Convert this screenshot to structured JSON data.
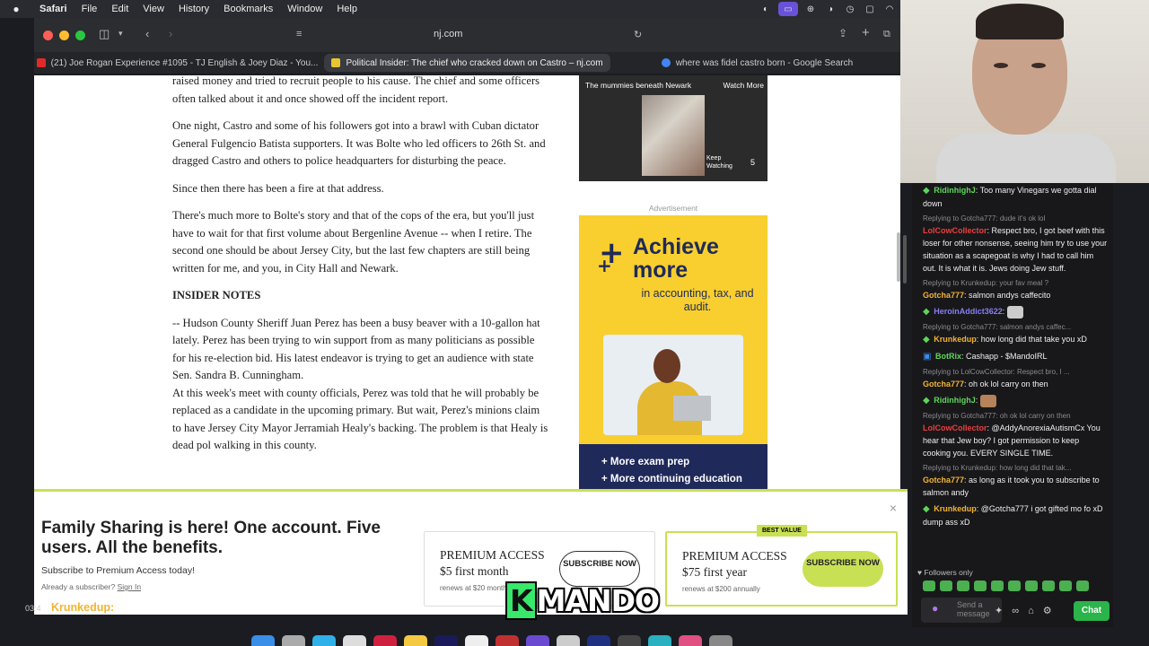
{
  "menubar": {
    "apple": "",
    "items": [
      "Safari",
      "File",
      "Edit",
      "View",
      "History",
      "Bookmarks",
      "Window",
      "Help"
    ]
  },
  "toolbar": {
    "url": "nj.com"
  },
  "tabs": [
    {
      "label": "(21) Joe Rogan Experience #1095 - TJ English & Joey Diaz - You...",
      "favicon_color": "#e02a2a"
    },
    {
      "label": "Political Insider: The chief who cracked down on Castro – nj.com",
      "favicon_color": "#e8c530"
    },
    {
      "label": "where was fidel castro born - Google Search",
      "favicon_color": "#4285f4"
    }
  ],
  "article": {
    "p0": "raised money and tried to recruit people to his cause. The chief and some officers often talked about it and once showed off the incident report.",
    "p1": "One night, Castro and some of his followers got into a brawl with Cuban dictator General Fulgencio Batista supporters. It was Bolte who led officers to 26th St. and dragged Castro and others to police headquarters for  disturbing the peace.",
    "p2": "Since then there has been a fire at that address.",
    "p3": "There's much more to Bolte's story and that of the cops of the era, but you'll just have to wait for that first volume about Bergenline Avenue -- when I retire. The second one should be about Jersey City, but the last few chapters are still being written for me, and you, in City Hall and Newark.",
    "heading": "INSIDER NOTES",
    "p4": "-- Hudson County Sheriff Juan Perez has been a busy beaver with a 10-gallon hat lately. Perez has been trying to win support from as many politicians as possible for his re-election bid. His latest endeavor is trying to get an audience with state Sen. Sandra B. Cunningham.",
    "p5": "At this week's meet with county officials, Perez was told that he will probably be replaced as a candidate in the upcoming primary. But wait, Perez's minions claim to have Jersey City Mayor Jerramiah Healy's backing. The problem is that Healy is dead pol walking in this county."
  },
  "video_ad": {
    "title": "The mummies beneath Newark",
    "watch": "Watch More",
    "keep": "Keep Watching",
    "count": "5"
  },
  "ad": {
    "label": "Advertisement",
    "headline1": "Achieve",
    "headline2": "more",
    "sub": "in accounting, tax, and audit.",
    "bullet1": "+ More exam prep",
    "bullet2": "+ More continuing education"
  },
  "premium": {
    "headline": "Family Sharing is here! One account. Five users. All the benefits.",
    "sub": "Subscribe to Premium Access today!",
    "already": "Already a subscriber?",
    "signin": "Sign In",
    "plan1": {
      "title": "PREMIUM ACCESS",
      "price": "$5 first month",
      "renew": "renews at $20 monthly",
      "button": "SUBSCRIBE NOW"
    },
    "plan2": {
      "badge": "BEST VALUE",
      "title": "PREMIUM ACCESS",
      "price": "$75 first year",
      "renew": "renews at $200 annually",
      "button": "SUBSCRIBE NOW"
    }
  },
  "overlay": {
    "timestamp": "03:4",
    "user": "Krunkedup:",
    "message": "@Gotcha777 i got gifted mo fo xD dump ass xD",
    "logo_k": "K",
    "logo_rest": "MANDO"
  },
  "chat": {
    "messages": [
      {
        "reply": "",
        "user": "RidinhighJ",
        "color": "#5fd55b",
        "text": "Too many Vinegars we gotta dial down",
        "gem": true
      },
      {
        "reply": "Replying to Gotcha777: dude it's ok lol",
        "user": "LolCowCollector",
        "color": "#e84040",
        "text": "Respect bro, I got beef with this loser for other nonsense, seeing him try to use your situation as a scapegoat is why I had to call him out. It is what it is. Jews doing Jew stuff.",
        "gem": false
      },
      {
        "reply": "Replying to Krunkedup: your fav meal ?",
        "user": "Gotcha777",
        "color": "#f2b431",
        "text": "salmon andys caffecito",
        "gem": false
      },
      {
        "reply": "",
        "user": "HeroinAddict3622",
        "color": "#8a7df0",
        "text": "",
        "gem": true
      },
      {
        "reply": "Replying to Gotcha777: salmon andys caffec...",
        "user": "Krunkedup",
        "color": "#f2b431",
        "text": "how long did that take you xD",
        "gem": true
      },
      {
        "reply": "",
        "user": "BotRix",
        "color": "#5fd55b",
        "text": "Cashapp - $MandoIRL",
        "gem": false
      },
      {
        "reply": "Replying to LolCowCollector: Respect bro, I ...",
        "user": "Gotcha777",
        "color": "#f2b431",
        "text": "oh ok lol carry on then",
        "gem": false
      },
      {
        "reply": "",
        "user": "RidinhighJ",
        "color": "#5fd55b",
        "text": "",
        "gem": true
      },
      {
        "reply": "Replying to Gotcha777: oh ok lol carry on then",
        "user": "LolCowCollector",
        "color": "#e84040",
        "text": "@AddyAnorexiaAutismCx You hear that Jew boy? I got permission to keep cooking you. EVERY SINGLE TIME.",
        "gem": false
      },
      {
        "reply": "Replying to Krunkedup: how long did that tak...",
        "user": "Gotcha777",
        "color": "#f2b431",
        "text": "as long as it took you to subscribe to salmon andy",
        "gem": false
      },
      {
        "reply": "",
        "user": "Krunkedup",
        "color": "#f2b431",
        "text": "@Gotcha777 i got gifted mo fo xD dump ass xD",
        "gem": true
      }
    ],
    "followers": "Followers only",
    "input_placeholder": "Send a message",
    "chat_button": "Chat"
  }
}
